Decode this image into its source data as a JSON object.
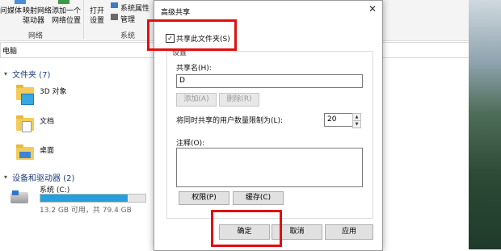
{
  "ribbon": {
    "media_label": "问媒体",
    "map_drive": "映射网络",
    "map_drive_2": "驱动器",
    "add_location": "添加一个",
    "add_location_2": "网络位置",
    "open_settings": "打开",
    "open_settings_2": "设置",
    "system_props": "系统属性",
    "manage": "管理",
    "group_network": "网络",
    "group_system": "系统"
  },
  "address": {
    "text": "电脑"
  },
  "nav": {
    "folders_header": "文件夹 (7)",
    "folders": [
      "3D 对象",
      "文档",
      "桌面"
    ],
    "devices_header": "设备和驱动器 (2)",
    "drive": {
      "name": "系统 (C:)",
      "space": "13.2 GB 可用，共 79.4 GB",
      "used_fraction": 0.83
    }
  },
  "dialog": {
    "title": "高级共享",
    "share_checkbox": "共享此文件夹(S)",
    "share_checked": true,
    "settings_legend": "设置",
    "share_name_label": "共享名(H):",
    "share_name_value": "D",
    "add_button": "添加(A)",
    "remove_button": "删除(R)",
    "limit_label": "将同时共享的用户数量限制为(L):",
    "limit_value": "20",
    "comment_label": "注释(O):",
    "permissions_button": "权限(P)",
    "caching_button": "缓存(C)",
    "ok_button": "确定",
    "cancel_button": "取消",
    "apply_button": "应用"
  },
  "colors": {
    "highlight": "#e01010",
    "drive_bar": "#26a0da",
    "folder": "#f3cb5a"
  }
}
